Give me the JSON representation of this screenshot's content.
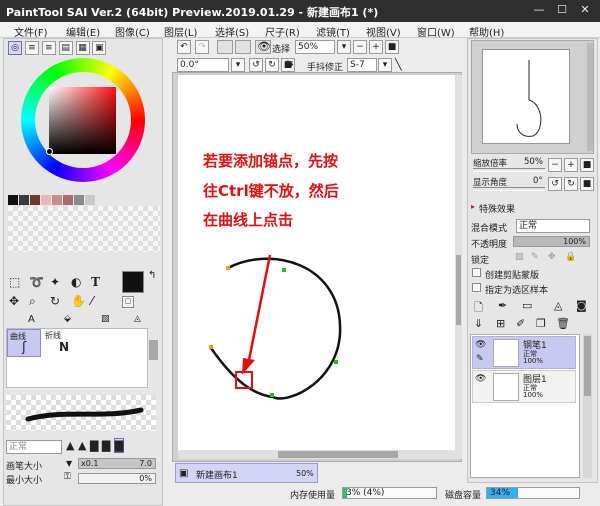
{
  "app": {
    "title": "PaintTool SAI Ver.2 (64bit) Preview.2019.01.29 - 新建画布1 (*)"
  },
  "window_controls": {
    "minimize": "—",
    "maximize": "☐",
    "close": "✕"
  },
  "menu": [
    "文件(F)",
    "编辑(E)",
    "图像(C)",
    "图层(L)",
    "选择(S)",
    "尺子(R)",
    "滤镜(T)",
    "视图(V)",
    "窗口(W)",
    "帮助(H)"
  ],
  "toolbar": {
    "select_label": "选择",
    "zoom": "50%",
    "rotation": "0.0°",
    "stabilizer_label": "手抖修正",
    "stabilizer": "S-7"
  },
  "swatches": [
    "#111111",
    "#3a3a3a",
    "#6a3a2a",
    "#e8b8b8",
    "#c88c8c",
    "#a86c6c",
    "#8a8a8a",
    "#c8c8c8"
  ],
  "tools": {
    "tab_a": "A",
    "curve_label": "曲线",
    "polyline_label": "折线",
    "curve_icon": "ʃ",
    "polyline_icon": "N",
    "text_tool": "T",
    "blend_mode": "正常",
    "brush_size_label": "画笔大小",
    "brush_size_mult": "x0.1",
    "brush_size": "7.0",
    "min_size_label": "最小大小",
    "min_size": "0%"
  },
  "annotation": {
    "line1": "若要添加锚点，先按",
    "line2": "往Ctrl键不放，然后",
    "line3": "在曲线上点击"
  },
  "canvas_tab": {
    "name": "新建画布1",
    "zoom": "50%"
  },
  "status": {
    "memory_label": "内存使用量",
    "memory": "3% (4%)",
    "memory_fill": 0.04,
    "disk_label": "磁盘容量",
    "disk": "34%",
    "disk_fill": 0.34
  },
  "navigator": {
    "zoom_label": "缩放倍率",
    "zoom": "50%",
    "angle_label": "显示角度",
    "angle": "0°"
  },
  "layer_panel": {
    "effects_label": "特殊效果",
    "blend_label": "混合模式",
    "blend_value": "正常",
    "opacity_label": "不透明度",
    "opacity": "100%",
    "opacity_fill": 1.0,
    "lock_label": "锁定",
    "clip_label": "创建剪贴蒙版",
    "sample_label": "指定为选区样本",
    "layers": [
      {
        "name": "钢笔1",
        "mode": "正常",
        "opacity": "100%"
      },
      {
        "name": "图层1",
        "mode": "正常",
        "opacity": "100%"
      }
    ]
  },
  "colors": {
    "accent_selection": "#c8c8f0",
    "annotation_red": "#e01010",
    "disk_fill": "#30b0f0",
    "memory_fill": "#30c070"
  }
}
